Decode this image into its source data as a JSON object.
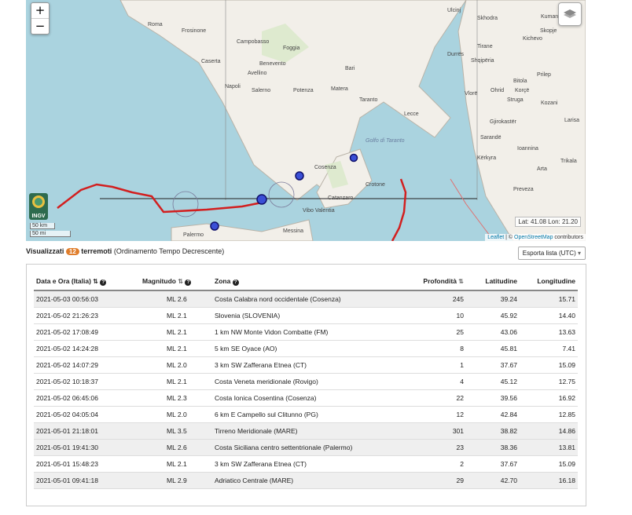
{
  "map": {
    "zoom_in": "+",
    "zoom_out": "−",
    "coords": "Lat: 41.08 Lon: 21.20",
    "scale_km": "50 km",
    "scale_mi": "50 mi",
    "logo": "INGV",
    "attribution_leaflet": "Leaflet",
    "attribution_sep": "| ©",
    "attribution_osm": "OpenStreetMap",
    "attribution_tail": "contributors",
    "place_labels": [
      "Roma",
      "Frosinone",
      "Campobasso",
      "Foggia",
      "Caserta",
      "Benevento",
      "Avellino",
      "Napoli",
      "Salerno",
      "Potenza",
      "Matera",
      "Bari",
      "Taranto",
      "Lecce",
      "Cosenza",
      "Crotone",
      "Catanzaro",
      "Vibo Valentia",
      "Messina",
      "Palermo",
      "Tirane",
      "Durrës",
      "Shqipëria",
      "Vlorë",
      "Sarandë",
      "Kërkyra",
      "Ioannina",
      "Arta",
      "Preveza",
      "Trikala",
      "Larisa",
      "Kozani",
      "Bitola",
      "Ohrid",
      "Prilep",
      "Struga",
      "Kichevo",
      "Kumanovo",
      "Skopje",
      "Korçë",
      "Gjirokastër",
      "Skhodra",
      "Ulcinj",
      "Golfo di Taranto"
    ],
    "accent": "#3a4fd6"
  },
  "controls": {
    "shown_prefix": "Visualizzati",
    "count": "12",
    "unit": "terremoti",
    "order": "(Ordinamento Tempo Decrescente)",
    "export_label": "Esporta lista (UTC)"
  },
  "table": {
    "headers": {
      "datetime": "Data e Ora (Italia)",
      "magnitude": "Magnitudo",
      "zone": "Zona",
      "depth": "Profondità",
      "lat": "Latitudine",
      "lon": "Longitudine"
    },
    "rows": [
      [
        "2021-05-03 00:56:03",
        "ML 2.6",
        "Costa Calabra nord occidentale (Cosenza)",
        "245",
        "39.24",
        "15.71"
      ],
      [
        "2021-05-02 21:26:23",
        "ML 2.1",
        "Slovenia (SLOVENIA)",
        "10",
        "45.92",
        "14.40"
      ],
      [
        "2021-05-02 17:08:49",
        "ML 2.1",
        "1 km NW Monte Vidon Combatte (FM)",
        "25",
        "43.06",
        "13.63"
      ],
      [
        "2021-05-02 14:24:28",
        "ML 2.1",
        "5 km SE Oyace (AO)",
        "8",
        "45.81",
        "7.41"
      ],
      [
        "2021-05-02 14:07:29",
        "ML 2.0",
        "3 km SW Zafferana Etnea (CT)",
        "1",
        "37.67",
        "15.09"
      ],
      [
        "2021-05-02 10:18:37",
        "ML 2.1",
        "Costa Veneta meridionale (Rovigo)",
        "4",
        "45.12",
        "12.75"
      ],
      [
        "2021-05-02 06:45:06",
        "ML 2.3",
        "Costa Ionica Cosentina (Cosenza)",
        "22",
        "39.56",
        "16.92"
      ],
      [
        "2021-05-02 04:05:04",
        "ML 2.0",
        "6 km E Campello sul Clitunno (PG)",
        "12",
        "42.84",
        "12.85"
      ],
      [
        "2021-05-01 21:18:01",
        "ML 3.5",
        "Tirreno Meridionale (MARE)",
        "301",
        "38.82",
        "14.86"
      ],
      [
        "2021-05-01 19:41:30",
        "ML 2.6",
        "Costa Siciliana centro settentrionale (Palermo)",
        "23",
        "38.36",
        "13.81"
      ],
      [
        "2021-05-01 15:48:23",
        "ML 2.1",
        "3 km SW Zafferana Etnea (CT)",
        "2",
        "37.67",
        "15.09"
      ],
      [
        "2021-05-01 09:41:18",
        "ML 2.9",
        "Adriatico Centrale (MARE)",
        "29",
        "42.70",
        "16.18"
      ]
    ]
  }
}
